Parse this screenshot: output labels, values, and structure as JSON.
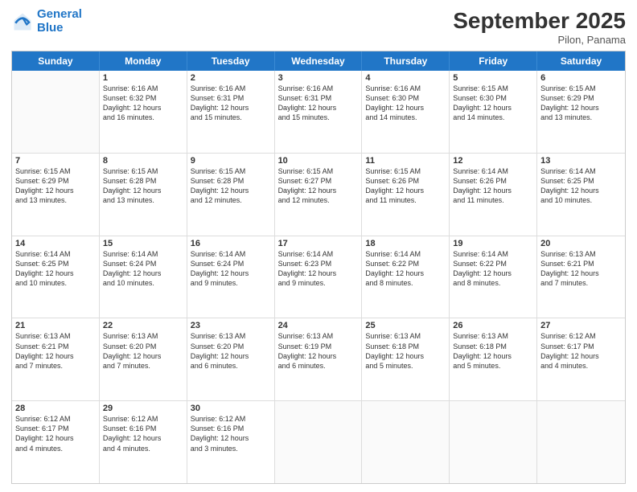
{
  "logo": {
    "line1": "General",
    "line2": "Blue"
  },
  "title": "September 2025",
  "subtitle": "Pilon, Panama",
  "days": [
    "Sunday",
    "Monday",
    "Tuesday",
    "Wednesday",
    "Thursday",
    "Friday",
    "Saturday"
  ],
  "weeks": [
    [
      {
        "day": null
      },
      {
        "day": "1",
        "rise": "6:16 AM",
        "set": "6:32 PM",
        "daylight": "12 hours and 16 minutes."
      },
      {
        "day": "2",
        "rise": "6:16 AM",
        "set": "6:31 PM",
        "daylight": "12 hours and 15 minutes."
      },
      {
        "day": "3",
        "rise": "6:16 AM",
        "set": "6:31 PM",
        "daylight": "12 hours and 15 minutes."
      },
      {
        "day": "4",
        "rise": "6:16 AM",
        "set": "6:30 PM",
        "daylight": "12 hours and 14 minutes."
      },
      {
        "day": "5",
        "rise": "6:15 AM",
        "set": "6:30 PM",
        "daylight": "12 hours and 14 minutes."
      },
      {
        "day": "6",
        "rise": "6:15 AM",
        "set": "6:29 PM",
        "daylight": "12 hours and 13 minutes."
      }
    ],
    [
      {
        "day": "7",
        "rise": "6:15 AM",
        "set": "6:29 PM",
        "daylight": "12 hours and 13 minutes."
      },
      {
        "day": "8",
        "rise": "6:15 AM",
        "set": "6:28 PM",
        "daylight": "12 hours and 13 minutes."
      },
      {
        "day": "9",
        "rise": "6:15 AM",
        "set": "6:28 PM",
        "daylight": "12 hours and 12 minutes."
      },
      {
        "day": "10",
        "rise": "6:15 AM",
        "set": "6:27 PM",
        "daylight": "12 hours and 12 minutes."
      },
      {
        "day": "11",
        "rise": "6:15 AM",
        "set": "6:26 PM",
        "daylight": "12 hours and 11 minutes."
      },
      {
        "day": "12",
        "rise": "6:14 AM",
        "set": "6:26 PM",
        "daylight": "12 hours and 11 minutes."
      },
      {
        "day": "13",
        "rise": "6:14 AM",
        "set": "6:25 PM",
        "daylight": "12 hours and 10 minutes."
      }
    ],
    [
      {
        "day": "14",
        "rise": "6:14 AM",
        "set": "6:25 PM",
        "daylight": "12 hours and 10 minutes."
      },
      {
        "day": "15",
        "rise": "6:14 AM",
        "set": "6:24 PM",
        "daylight": "12 hours and 10 minutes."
      },
      {
        "day": "16",
        "rise": "6:14 AM",
        "set": "6:24 PM",
        "daylight": "12 hours and 9 minutes."
      },
      {
        "day": "17",
        "rise": "6:14 AM",
        "set": "6:23 PM",
        "daylight": "12 hours and 9 minutes."
      },
      {
        "day": "18",
        "rise": "6:14 AM",
        "set": "6:22 PM",
        "daylight": "12 hours and 8 minutes."
      },
      {
        "day": "19",
        "rise": "6:14 AM",
        "set": "6:22 PM",
        "daylight": "12 hours and 8 minutes."
      },
      {
        "day": "20",
        "rise": "6:13 AM",
        "set": "6:21 PM",
        "daylight": "12 hours and 7 minutes."
      }
    ],
    [
      {
        "day": "21",
        "rise": "6:13 AM",
        "set": "6:21 PM",
        "daylight": "12 hours and 7 minutes."
      },
      {
        "day": "22",
        "rise": "6:13 AM",
        "set": "6:20 PM",
        "daylight": "12 hours and 7 minutes."
      },
      {
        "day": "23",
        "rise": "6:13 AM",
        "set": "6:20 PM",
        "daylight": "12 hours and 6 minutes."
      },
      {
        "day": "24",
        "rise": "6:13 AM",
        "set": "6:19 PM",
        "daylight": "12 hours and 6 minutes."
      },
      {
        "day": "25",
        "rise": "6:13 AM",
        "set": "6:18 PM",
        "daylight": "12 hours and 5 minutes."
      },
      {
        "day": "26",
        "rise": "6:13 AM",
        "set": "6:18 PM",
        "daylight": "12 hours and 5 minutes."
      },
      {
        "day": "27",
        "rise": "6:12 AM",
        "set": "6:17 PM",
        "daylight": "12 hours and 4 minutes."
      }
    ],
    [
      {
        "day": "28",
        "rise": "6:12 AM",
        "set": "6:17 PM",
        "daylight": "12 hours and 4 minutes."
      },
      {
        "day": "29",
        "rise": "6:12 AM",
        "set": "6:16 PM",
        "daylight": "12 hours and 4 minutes."
      },
      {
        "day": "30",
        "rise": "6:12 AM",
        "set": "6:16 PM",
        "daylight": "12 hours and 3 minutes."
      },
      {
        "day": null
      },
      {
        "day": null
      },
      {
        "day": null
      },
      {
        "day": null
      }
    ]
  ],
  "labels": {
    "sunrise": "Sunrise:",
    "sunset": "Sunset:",
    "daylight": "Daylight:"
  }
}
